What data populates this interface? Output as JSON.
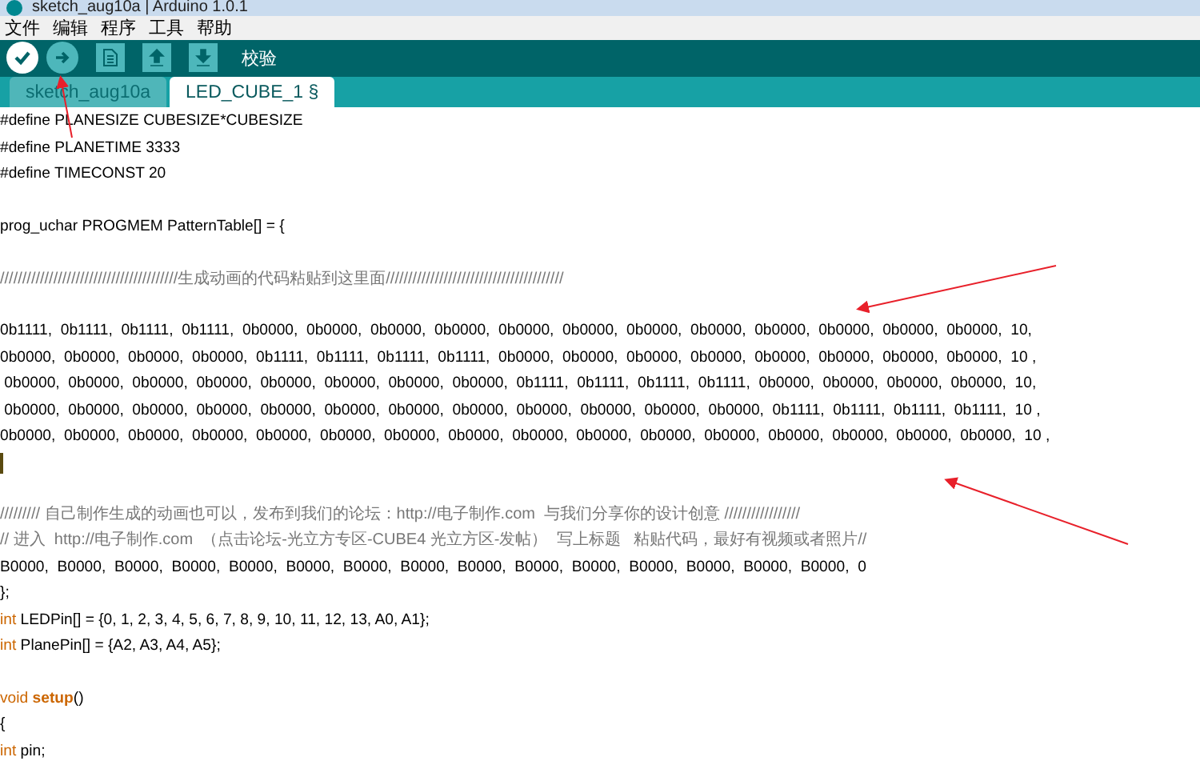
{
  "window": {
    "title": "sketch_aug10a | Arduino 1.0.1"
  },
  "menu": [
    "文件",
    "编辑",
    "程序",
    "工具",
    "帮助"
  ],
  "toolbar": {
    "buttons": [
      {
        "kind": "verify",
        "selected": true
      },
      {
        "kind": "upload",
        "selected": false
      },
      {
        "kind": "new",
        "selected": false
      },
      {
        "kind": "open",
        "selected": false
      },
      {
        "kind": "save",
        "selected": false
      }
    ],
    "label": "校验"
  },
  "tabs": [
    {
      "label": "sketch_aug10a",
      "selected": false
    },
    {
      "label": "LED_CUBE_1 §",
      "selected": true
    }
  ],
  "code": [
    {
      "kind": "code",
      "segments": [
        {
          "kind": "plain",
          "text": "#define PLANESIZE CUBESIZE*CUBESIZE"
        }
      ]
    },
    {
      "kind": "code",
      "segments": [
        {
          "kind": "plain",
          "text": "#define PLANETIME 3333"
        }
      ]
    },
    {
      "kind": "code",
      "segments": [
        {
          "kind": "plain",
          "text": "#define TIMECONST 20"
        }
      ]
    },
    {
      "kind": "blank"
    },
    {
      "kind": "code",
      "segments": [
        {
          "kind": "plain",
          "text": "prog_uchar PROGMEM PatternTable[] = {"
        }
      ]
    },
    {
      "kind": "blank"
    },
    {
      "kind": "code",
      "segments": [
        {
          "kind": "comment",
          "text": "////////////////////////////////////////生成动画的代码粘贴到这里面////////////////////////////////////////"
        }
      ]
    },
    {
      "kind": "blank"
    },
    {
      "kind": "code",
      "segments": [
        {
          "kind": "plain",
          "text": "0b1111,  0b1111,  0b1111,  0b1111,  0b0000,  0b0000,  0b0000,  0b0000,  0b0000,  0b0000,  0b0000,  0b0000,  0b0000,  0b0000,  0b0000,  0b0000,  10,"
        }
      ]
    },
    {
      "kind": "code",
      "segments": [
        {
          "kind": "plain",
          "text": "0b0000,  0b0000,  0b0000,  0b0000,  0b1111,  0b1111,  0b1111,  0b1111,  0b0000,  0b0000,  0b0000,  0b0000,  0b0000,  0b0000,  0b0000,  0b0000,  10 ,"
        }
      ]
    },
    {
      "kind": "code",
      "segments": [
        {
          "kind": "plain",
          "text": " 0b0000,  0b0000,  0b0000,  0b0000,  0b0000,  0b0000,  0b0000,  0b0000,  0b1111,  0b1111,  0b1111,  0b1111,  0b0000,  0b0000,  0b0000,  0b0000,  10,"
        }
      ]
    },
    {
      "kind": "code",
      "segments": [
        {
          "kind": "plain",
          "text": " 0b0000,  0b0000,  0b0000,  0b0000,  0b0000,  0b0000,  0b0000,  0b0000,  0b0000,  0b0000,  0b0000,  0b0000,  0b1111,  0b1111,  0b1111,  0b1111,  10 ,"
        }
      ]
    },
    {
      "kind": "code",
      "segments": [
        {
          "kind": "plain",
          "text": "0b0000,  0b0000,  0b0000,  0b0000,  0b0000,  0b0000,  0b0000,  0b0000,  0b0000,  0b0000,  0b0000,  0b0000,  0b0000,  0b0000,  0b0000,  0b0000,  10 ,"
        }
      ]
    },
    {
      "kind": "cursor"
    },
    {
      "kind": "blank"
    },
    {
      "kind": "code",
      "segments": [
        {
          "kind": "comment",
          "text": "///////// 自己制作生成的动画也可以，发布到我们的论坛：http://电子制作.com  与我们分享你的设计创意 /////////////////"
        }
      ]
    },
    {
      "kind": "code",
      "segments": [
        {
          "kind": "comment",
          "text": "// 进入  http://电子制作.com  （点击论坛-光立方专区-CUBE4 光立方区-发帖）  写上标题   粘贴代码，最好有视频或者照片//"
        }
      ]
    },
    {
      "kind": "code",
      "segments": [
        {
          "kind": "plain",
          "text": "B0000,  B0000,  B0000,  B0000,  B0000,  B0000,  B0000,  B0000,  B0000,  B0000,  B0000,  B0000,  B0000,  B0000,  B0000,  0"
        }
      ]
    },
    {
      "kind": "code",
      "segments": [
        {
          "kind": "plain",
          "text": "};"
        }
      ]
    },
    {
      "kind": "code",
      "segments": [
        {
          "kind": "keyword",
          "text": "int"
        },
        {
          "kind": "plain",
          "text": " LEDPin[] = {0, 1, 2, 3, 4, 5, 6, 7, 8, 9, 10, 11, 12, 13, A0, A1};"
        }
      ]
    },
    {
      "kind": "code",
      "segments": [
        {
          "kind": "keyword",
          "text": "int"
        },
        {
          "kind": "plain",
          "text": " PlanePin[] = {A2, A3, A4, A5};"
        }
      ]
    },
    {
      "kind": "blank"
    },
    {
      "kind": "code",
      "segments": [
        {
          "kind": "keyword",
          "text": "void"
        },
        {
          "kind": "function",
          "text": " setup"
        },
        {
          "kind": "plain",
          "text": "()"
        }
      ]
    },
    {
      "kind": "code",
      "segments": [
        {
          "kind": "plain",
          "text": "{"
        }
      ]
    },
    {
      "kind": "code",
      "segments": [
        {
          "kind": "keyword",
          "text": "int"
        },
        {
          "kind": "plain",
          "text": " pin;"
        }
      ]
    }
  ]
}
